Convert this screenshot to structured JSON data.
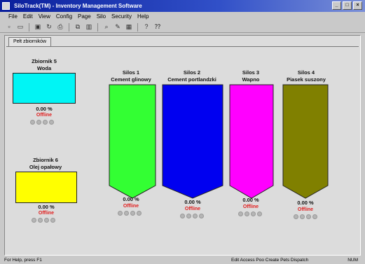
{
  "window": {
    "title": "SiloTrack(TM) - Inventory Management Software",
    "buttons": {
      "minimize": "_",
      "maximize": "□",
      "close": "×"
    }
  },
  "menu": [
    "File",
    "Edit",
    "View",
    "Config",
    "Page",
    "Silo",
    "Security",
    "Help"
  ],
  "toolbar": {
    "icons": [
      "new-icon",
      "open-icon",
      "save-icon",
      "refresh-icon",
      "print-icon",
      "copy-icon",
      "chart-icon",
      "zoom-icon",
      "edit-icon",
      "grid-icon",
      "info-icon",
      "help-icon"
    ]
  },
  "tab": {
    "label": "Pełt zbiorników"
  },
  "tanks": [
    {
      "name": "Zbiornik 5",
      "material": "Woda",
      "percent": "0.00 %",
      "status": "Offline",
      "color": "#00f5f5",
      "level": 0
    },
    {
      "name": "Zbiornik 6",
      "material": "Olej opałowy",
      "percent": "0.00 %",
      "status": "Offline",
      "color": "#ffff00",
      "level": 0
    }
  ],
  "silos": [
    {
      "name": "Silos 1",
      "material": "Cement glinowy",
      "percent": "0.00 %",
      "status": "Offline",
      "color": "#33ff33",
      "level": 0
    },
    {
      "name": "Silos 2",
      "material": "Cement portlandzki",
      "percent": "0.00 %",
      "status": "Offline",
      "color": "#0000f0",
      "level": 0
    },
    {
      "name": "Silos 3",
      "material": "Wapno",
      "percent": "0.00 %",
      "status": "Offline",
      "color": "#ff00ff",
      "level": 0
    },
    {
      "name": "Silos 4",
      "material": "Piasek suszony",
      "percent": "0.00 %",
      "status": "Offline",
      "color": "#808000",
      "level": 0
    }
  ],
  "statusbar": {
    "left": "For Help, press F1",
    "right": "Edit Access   Poo Create Pets Dispatch",
    "mode": "NUM"
  }
}
